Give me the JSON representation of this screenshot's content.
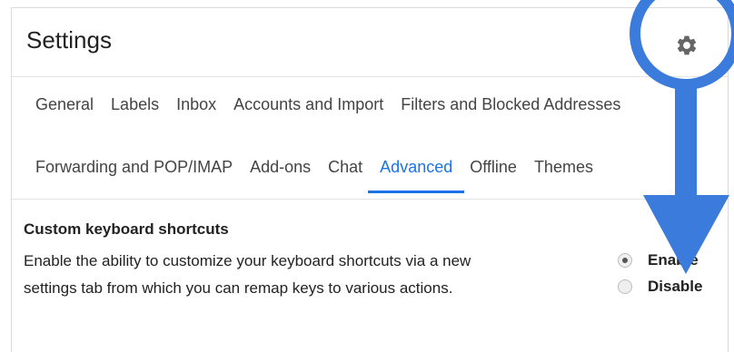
{
  "header": {
    "title": "Settings",
    "settings_icon": "gear-icon"
  },
  "tabs": {
    "row1": [
      "General",
      "Labels",
      "Inbox",
      "Accounts and Import",
      "Filters and Blocked Addresses"
    ],
    "row2": [
      "Forwarding and POP/IMAP",
      "Add-ons",
      "Chat",
      "Advanced",
      "Offline",
      "Themes"
    ],
    "active": "Advanced"
  },
  "section": {
    "title": "Custom keyboard shortcuts",
    "description": "Enable the ability to customize your keyboard shortcuts via a new settings tab from which you can remap keys to various actions.",
    "options": [
      {
        "label": "Enable",
        "selected": true
      },
      {
        "label": "Disable",
        "selected": false
      }
    ]
  },
  "annotation": {
    "color": "#3a7bdc",
    "highlight": "circle around gear-icon",
    "arrow": "down-arrow"
  }
}
